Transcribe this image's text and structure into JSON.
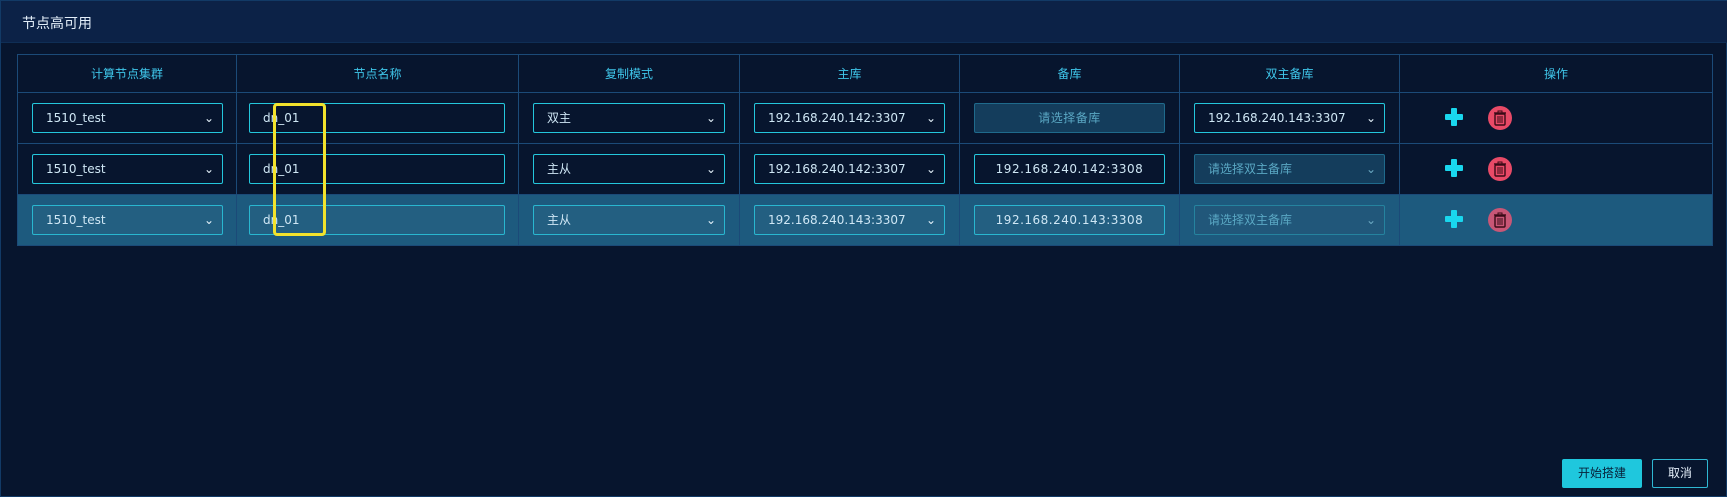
{
  "dialog": {
    "title": "节点高可用"
  },
  "table": {
    "headers": [
      "计算节点集群",
      "节点名称",
      "复制模式",
      "主库",
      "备库",
      "双主备库",
      "操作"
    ],
    "rows": [
      {
        "cluster": "1510_test",
        "node_name": "dn_01",
        "mode": "双主",
        "master": "192.168.240.142:3307",
        "slave": "",
        "slave_placeholder": "请选择备库",
        "dual_master": "192.168.240.143:3307",
        "dual_master_placeholder": ""
      },
      {
        "cluster": "1510_test",
        "node_name": "dn_01",
        "mode": "主从",
        "master": "192.168.240.142:3307",
        "slave": "192.168.240.142:3308",
        "slave_placeholder": "",
        "dual_master": "",
        "dual_master_placeholder": "请选择双主备库"
      },
      {
        "cluster": "1510_test",
        "node_name": "dn_01",
        "mode": "主从",
        "master": "192.168.240.143:3307",
        "slave": "192.168.240.143:3308",
        "slave_placeholder": "",
        "dual_master": "",
        "dual_master_placeholder": "请选择双主备库"
      }
    ]
  },
  "footer": {
    "start_label": "开始搭建",
    "cancel_label": "取消"
  },
  "icons": {
    "add": "plus-icon",
    "delete": "trash-icon",
    "dropdown": "chevron-down-icon"
  },
  "colors": {
    "accent": "#1fc7dd",
    "danger": "#e84a67",
    "highlight": "#f2e22c",
    "selected_row": "#1d5a7e"
  }
}
